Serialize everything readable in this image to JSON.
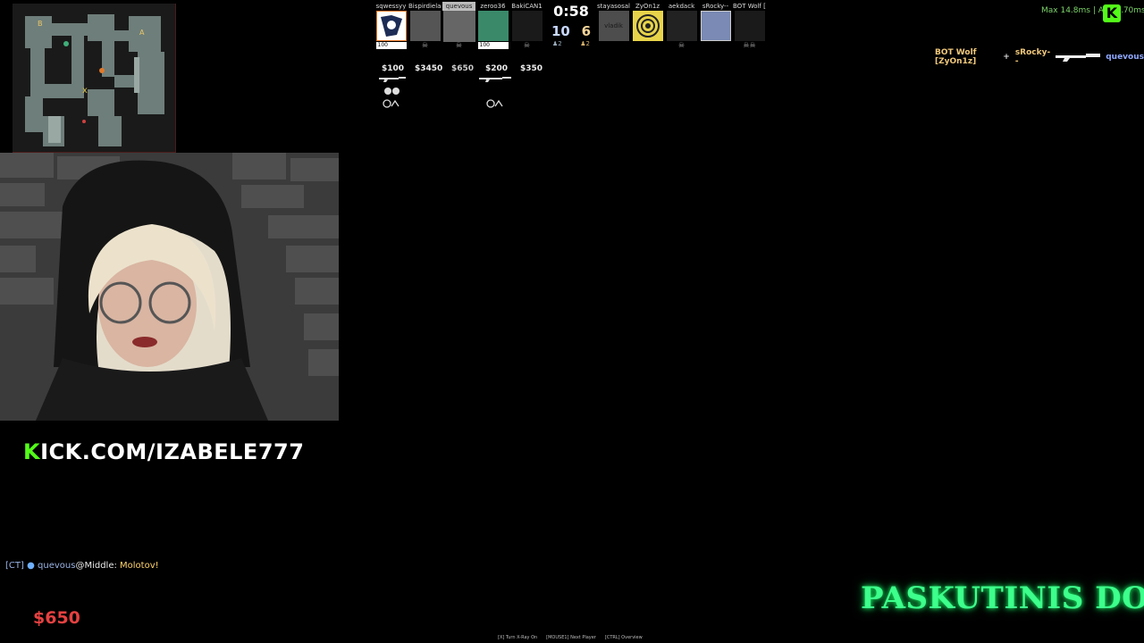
{
  "radar": {
    "site_a": "A",
    "site_b": "B"
  },
  "scoreboard": {
    "time": "0:58",
    "ct_score": "10",
    "t_score": "6",
    "ct_alive": "♟2",
    "t_alive": "♟2",
    "ct_players": [
      {
        "name": "sqwessyy",
        "money": "$100",
        "hp": "100"
      },
      {
        "name": "Bispirdielas",
        "money": "$3450",
        "hp": ""
      },
      {
        "name": "quevous",
        "money": "$650",
        "hp": ""
      },
      {
        "name": "zeroo36",
        "money": "$200",
        "hp": "100"
      },
      {
        "name": "BakiCAN1",
        "money": "$350",
        "hp": ""
      }
    ],
    "t_players": [
      {
        "name": "stayasosal",
        "avatar_text": "vladik"
      },
      {
        "name": "ZyOn1z"
      },
      {
        "name": "aekdack"
      },
      {
        "name": "sRocky--"
      },
      {
        "name": "BOT Wolf [Z..."
      }
    ]
  },
  "netstats": "Max  14.8ms | Avg 0.70ms",
  "kick_badge": "K",
  "killfeed": {
    "attacker": "BOT Wolf [ZyOn1z]",
    "plus": "+",
    "assist": "sRocky--",
    "victim": "quevous"
  },
  "kick_link": {
    "k": "K",
    "rest": "ICK.COM/IZABELE777"
  },
  "chat": {
    "team_tag": "[CT]",
    "dot": "●",
    "name": "quevous",
    "location": "@Middle:",
    "message": "Molotov!"
  },
  "cash": "$650",
  "hints": [
    "[X] Turn X-Ray On",
    "[MOUSE1] Next Player",
    "[CTRL] Overview"
  ],
  "overlay_text": "PASKUTINIS DO",
  "colors": {
    "kick_green": "#53fc18",
    "cash_red": "#e64141",
    "overlay_green": "#3dff8c"
  }
}
